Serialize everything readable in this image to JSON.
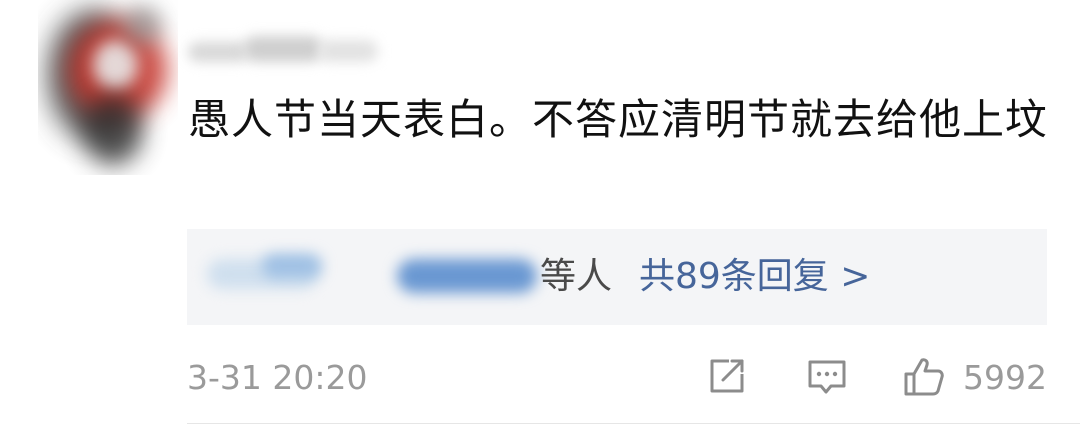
{
  "comment": {
    "text": "愚人节当天表白。不答应清明节就去给他上坟",
    "reply_suffix": "等人",
    "reply_link": "共89条回复 >",
    "timestamp": "3-31 20:20",
    "like_count": "5992",
    "icons": {
      "share": "share-icon",
      "reply": "comment-icon",
      "like": "thumbs-up-icon"
    },
    "colors": {
      "link": "#46659a",
      "meta": "#9a9a9a",
      "reply_bg": "#f4f5f7"
    }
  }
}
